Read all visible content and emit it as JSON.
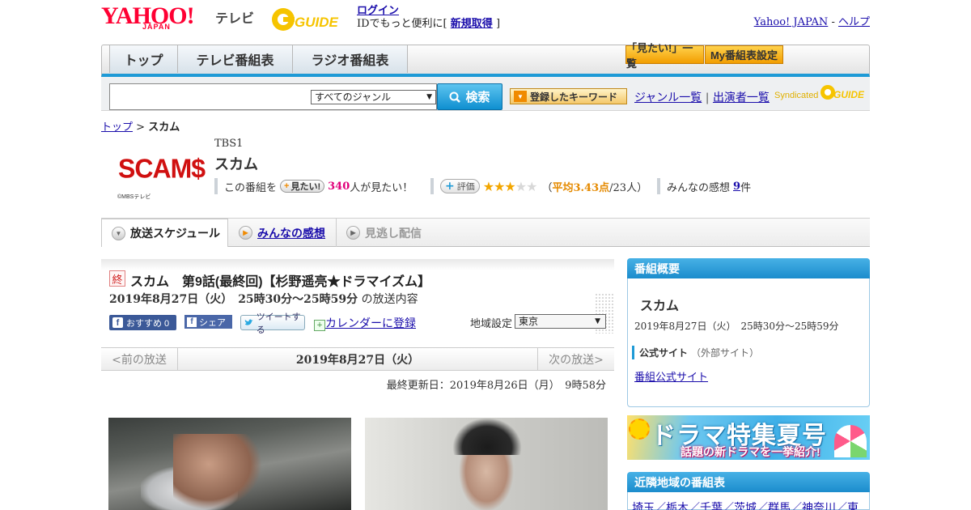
{
  "header": {
    "logo_yahoo": "YAHOO!",
    "logo_japan": "JAPAN",
    "logo_tv": "テレビ",
    "gguide": "GUIDE",
    "login_label": "ログイン",
    "id_text_pre": "IDでもっと便利に[",
    "register_label": "新規取得",
    "id_text_post": "]",
    "yahoo_japan_link": "Yahoo! JAPAN",
    "separator": "-",
    "help_link": "ヘルプ"
  },
  "nav": {
    "tabs": [
      "トップ",
      "テレビ番組表",
      "ラジオ番組表"
    ],
    "mitai_list": "「見たい!」一覧",
    "my_schedule": "My番組表設定"
  },
  "search": {
    "genre_selected": "すべてのジャンル",
    "search_button": "検索",
    "keyword_button": "登録したキーワード",
    "genre_list": "ジャンル一覧",
    "pipe": "|",
    "cast_list": "出演者一覧",
    "syndicated": "Syndicated",
    "synd_guide": "GUIDE"
  },
  "breadcrumb": {
    "top": "トップ",
    "sep": ">",
    "current": "スカム"
  },
  "program": {
    "logo_text": "SCAM$",
    "logo_credit": "©MBSテレビ",
    "channel": "TBS1",
    "title": "スカム",
    "mitai_pre": "この番組を",
    "mitai_btn": "見たい!",
    "mitai_count": "340",
    "mitai_post": "人が見たい！",
    "eval_btn": "評価",
    "rating_stars": 3,
    "rating_prefix": "（",
    "rating_label": "平均3.43点",
    "rating_count": "/23人）",
    "impressions_pre": "みんなの感想",
    "impressions_count": "9",
    "impressions_post": "件"
  },
  "tabs": {
    "schedule": "放送スケジュール",
    "impressions": "みんなの感想",
    "catchup": "見逃し配信"
  },
  "episode": {
    "ended_badge": "終",
    "title": "スカム　第9話(最終回)【杉野遥亮★ドラマイズム】",
    "datetime": "2019年8月27日（火）　25時30分～25時59分",
    "datetime_suffix": "の放送内容",
    "fb_recommend": "おすすめ 0",
    "fb_share": "シェア",
    "tweet": "ツイートする",
    "calendar": "カレンダーに登録",
    "region_label": "地域設定",
    "region_value": "東京",
    "prev": "<前の放送",
    "current_date": "2019年8月27日（火）",
    "next": "次の放送>",
    "last_updated": "最終更新日：2019年8月26日（月）　9時58分"
  },
  "sidebar": {
    "overview_head": "番組概要",
    "title": "スカム",
    "datetime": "2019年8月27日（火）　25時30分～25時59分",
    "official_label": "公式サイト",
    "official_note": "（外部サイト）",
    "official_link": "番組公式サイト",
    "drama_big": "ドラマ特集夏号",
    "drama_small": "話題の新ドラマを一挙紹介!",
    "nearby_head": "近隣地域の番組表",
    "nearby_regions": "埼玉／栃木／千葉／茨城／群馬／神奈川／東"
  },
  "colors": {
    "accent_blue": "#1e9ad6",
    "yahoo_red": "#ff0033",
    "rating_orange": "#e58a00",
    "count_pink": "#e0007a"
  }
}
